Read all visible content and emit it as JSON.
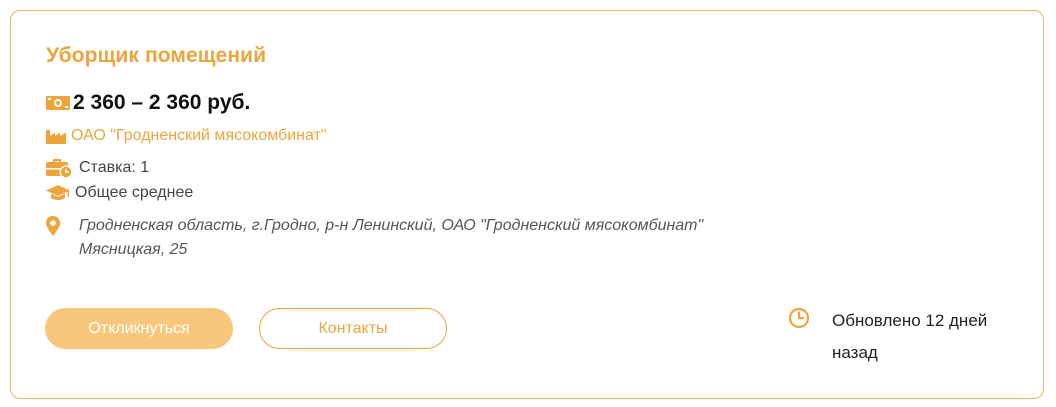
{
  "vacancy": {
    "title": "Уборщик помещений",
    "salary": "2 360 – 2 360 руб.",
    "company": "ОАО \"Гродненский мясокомбинат\"",
    "rate": "Ставка: 1",
    "education": "Общее среднее",
    "address_line1": "Гродненская область, г.Гродно, р-н Ленинский, ОАО \"Гродненский мясокомбинат\"",
    "address_line2": "Мясницкая, 25"
  },
  "actions": {
    "respond_label": "Откликнуться",
    "contacts_label": "Контакты"
  },
  "meta": {
    "updated": "Обновлено 12 дней назад"
  },
  "icons": {
    "salary": "money-icon",
    "company": "factory-icon",
    "rate": "briefcase-clock-icon",
    "education": "graduation-cap-icon",
    "address": "location-pin-icon",
    "updated": "clock-icon"
  },
  "colors": {
    "accent": "#eda43b",
    "border": "#e9b765",
    "button_fill": "#f8c77c",
    "text": "#111111",
    "muted": "#444444"
  }
}
